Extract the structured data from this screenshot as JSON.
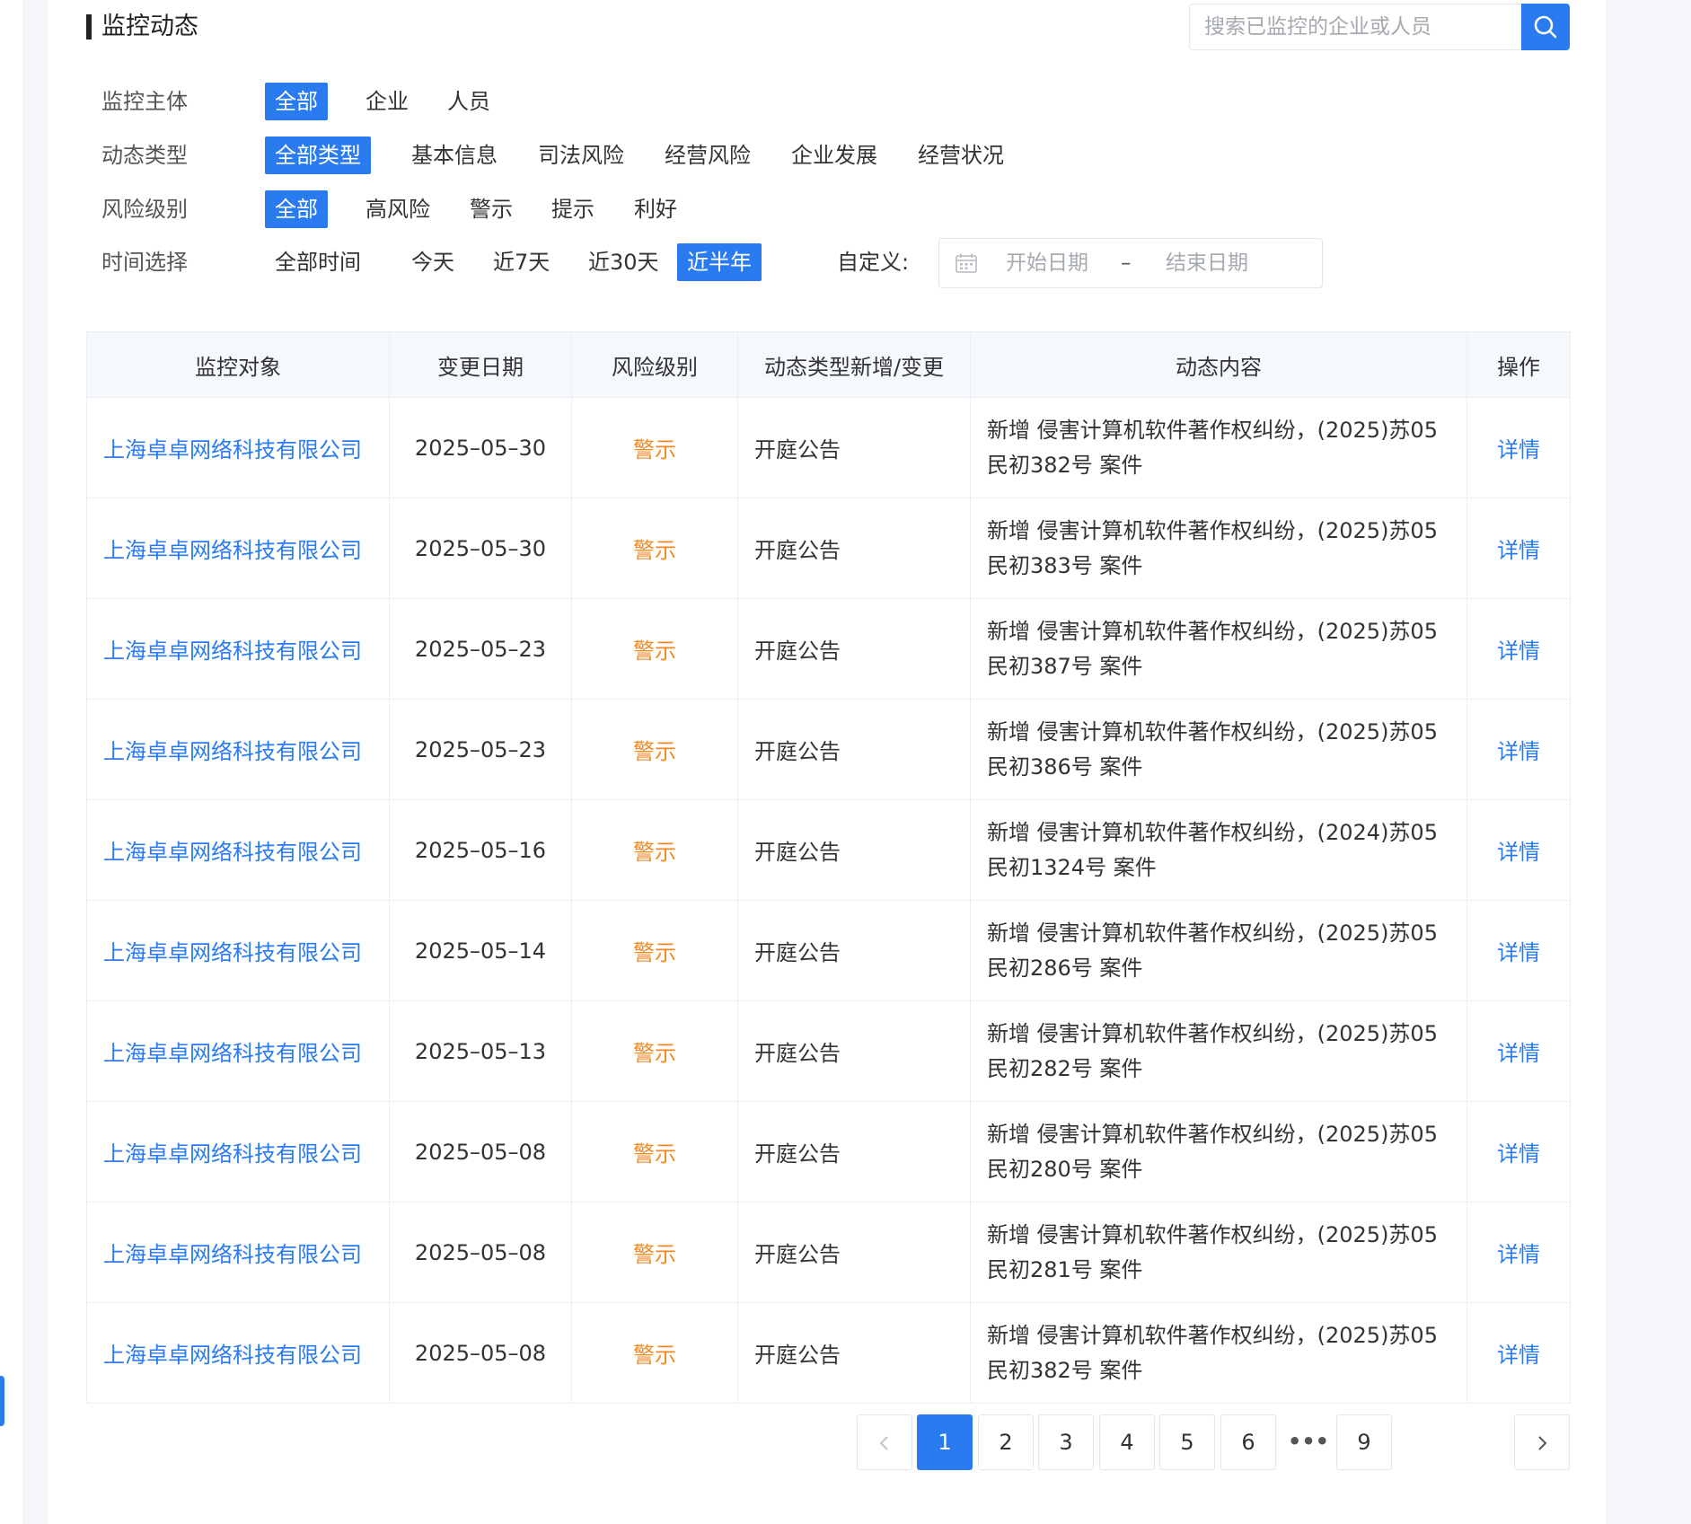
{
  "header": {
    "title": "监控动态",
    "search_placeholder": "搜索已监控的企业或人员"
  },
  "filters": {
    "subject": {
      "label": "监控主体",
      "options": [
        "全部",
        "企业",
        "人员"
      ],
      "active": "全部"
    },
    "type": {
      "label": "动态类型",
      "options": [
        "全部类型",
        "基本信息",
        "司法风险",
        "经营风险",
        "企业发展",
        "经营状况"
      ],
      "active": "全部类型"
    },
    "risk": {
      "label": "风险级别",
      "options": [
        "全部",
        "高风险",
        "警示",
        "提示",
        "利好"
      ],
      "active": "全部"
    },
    "time": {
      "label": "时间选择",
      "options": [
        "全部时间",
        "今天",
        "近7天",
        "近30天",
        "近半年"
      ],
      "active": "近半年",
      "custom_label": "自定义:",
      "start_placeholder": "开始日期",
      "separator": "–",
      "end_placeholder": "结束日期"
    }
  },
  "table": {
    "columns": [
      "监控对象",
      "变更日期",
      "风险级别",
      "动态类型新增/变更",
      "动态内容",
      "操作"
    ],
    "rows": [
      {
        "name": "上海卓卓网络科技有限公司",
        "date": "2025–05–30",
        "risk": "警示",
        "type": "开庭公告",
        "content": "新增 侵害计算机软件著作权纠纷，(2025)苏05民初382号 案件",
        "op": "详情"
      },
      {
        "name": "上海卓卓网络科技有限公司",
        "date": "2025–05–30",
        "risk": "警示",
        "type": "开庭公告",
        "content": "新增 侵害计算机软件著作权纠纷，(2025)苏05民初383号 案件",
        "op": "详情"
      },
      {
        "name": "上海卓卓网络科技有限公司",
        "date": "2025–05–23",
        "risk": "警示",
        "type": "开庭公告",
        "content": "新增 侵害计算机软件著作权纠纷，(2025)苏05民初387号 案件",
        "op": "详情"
      },
      {
        "name": "上海卓卓网络科技有限公司",
        "date": "2025–05–23",
        "risk": "警示",
        "type": "开庭公告",
        "content": "新增 侵害计算机软件著作权纠纷，(2025)苏05民初386号 案件",
        "op": "详情"
      },
      {
        "name": "上海卓卓网络科技有限公司",
        "date": "2025–05–16",
        "risk": "警示",
        "type": "开庭公告",
        "content": "新增 侵害计算机软件著作权纠纷，(2024)苏05民初1324号 案件",
        "op": "详情"
      },
      {
        "name": "上海卓卓网络科技有限公司",
        "date": "2025–05–14",
        "risk": "警示",
        "type": "开庭公告",
        "content": "新增 侵害计算机软件著作权纠纷，(2025)苏05民初286号 案件",
        "op": "详情"
      },
      {
        "name": "上海卓卓网络科技有限公司",
        "date": "2025–05–13",
        "risk": "警示",
        "type": "开庭公告",
        "content": "新增 侵害计算机软件著作权纠纷，(2025)苏05民初282号 案件",
        "op": "详情"
      },
      {
        "name": "上海卓卓网络科技有限公司",
        "date": "2025–05–08",
        "risk": "警示",
        "type": "开庭公告",
        "content": "新增 侵害计算机软件著作权纠纷，(2025)苏05民初280号 案件",
        "op": "详情"
      },
      {
        "name": "上海卓卓网络科技有限公司",
        "date": "2025–05–08",
        "risk": "警示",
        "type": "开庭公告",
        "content": "新增 侵害计算机软件著作权纠纷，(2025)苏05民初281号 案件",
        "op": "详情"
      },
      {
        "name": "上海卓卓网络科技有限公司",
        "date": "2025–05–08",
        "risk": "警示",
        "type": "开庭公告",
        "content": "新增 侵害计算机软件著作权纠纷，(2025)苏05民初382号 案件",
        "op": "详情"
      }
    ]
  },
  "pagination": {
    "pages": [
      "1",
      "2",
      "3",
      "4",
      "5",
      "6",
      "•••",
      "9"
    ],
    "current": "1"
  },
  "colors": {
    "accent": "#2b7bf0",
    "warning": "#f08a24"
  },
  "icons": {
    "search": "search-icon",
    "calendar": "calendar-icon",
    "prev": "chevron-left-icon",
    "next": "chevron-right-icon"
  }
}
